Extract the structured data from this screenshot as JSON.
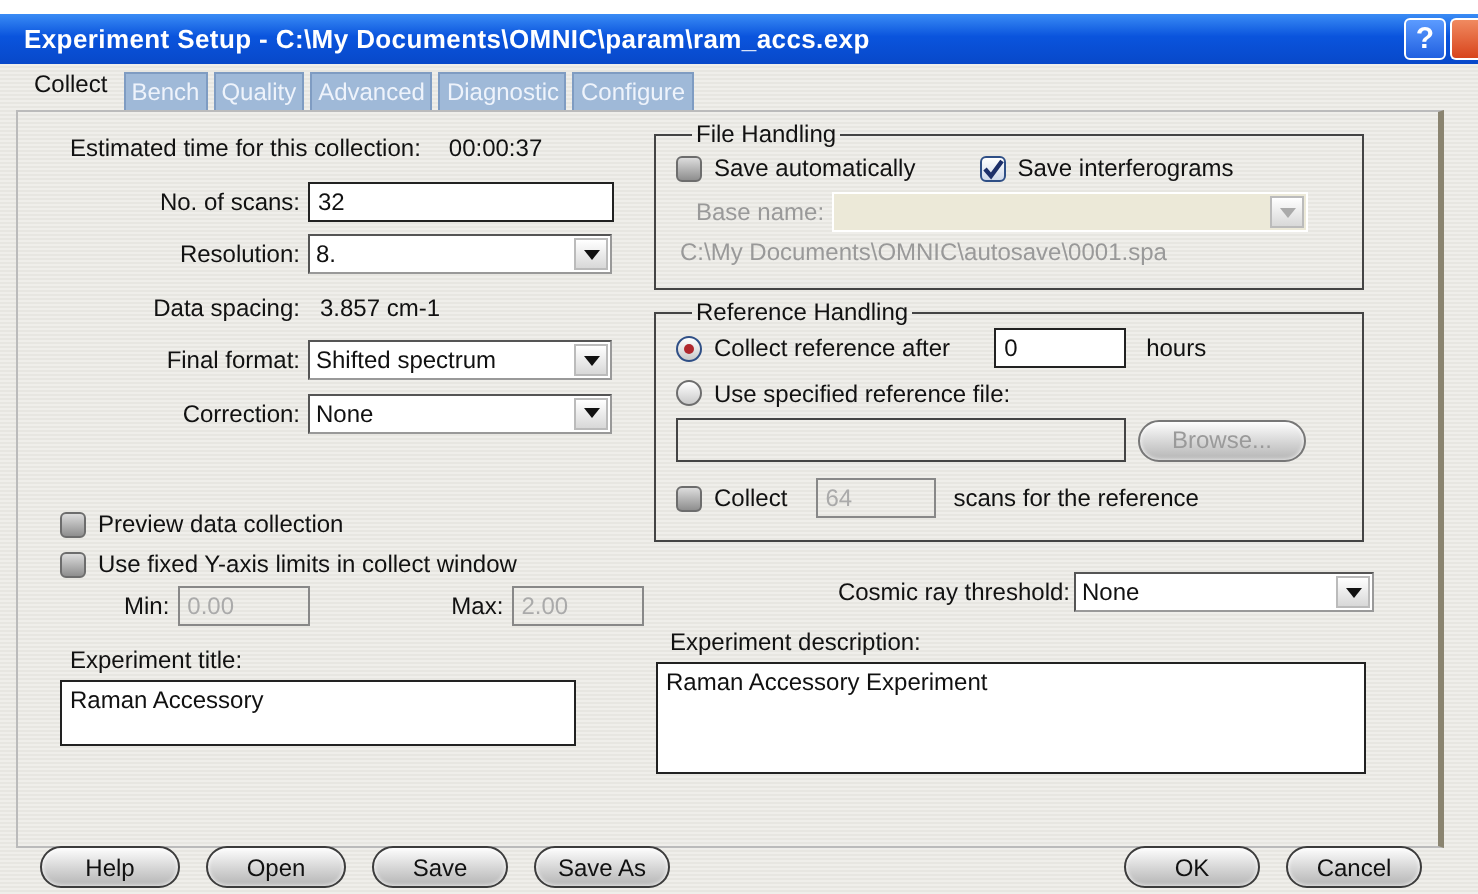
{
  "window": {
    "title": "Experiment Setup - C:\\My Documents\\OMNIC\\param\\ram_accs.exp",
    "help_button": "?"
  },
  "tabs": [
    {
      "label": "Collect",
      "selected": true
    },
    {
      "label": "Bench",
      "selected": false
    },
    {
      "label": "Quality",
      "selected": false
    },
    {
      "label": "Advanced",
      "selected": false
    },
    {
      "label": "Diagnostic",
      "selected": false
    },
    {
      "label": "Configure",
      "selected": false
    }
  ],
  "estimate": {
    "label": "Estimated time for this collection:",
    "value": "00:00:37"
  },
  "left_fields": [
    {
      "kind": "input",
      "label": "No. of scans:",
      "value": "32"
    },
    {
      "kind": "dropdown",
      "label": "Resolution:",
      "value": "8."
    },
    {
      "kind": "text",
      "label": "Data spacing:",
      "value": "3.857 cm-1"
    },
    {
      "kind": "dropdown",
      "label": "Final format:",
      "value": "Shifted spectrum"
    },
    {
      "kind": "dropdown",
      "label": "Correction:",
      "value": "None"
    }
  ],
  "options": [
    {
      "label": "Preview data collection",
      "checked": false
    },
    {
      "label": "Use fixed Y-axis limits in collect window",
      "checked": false
    }
  ],
  "limits": [
    {
      "label": "Min:",
      "value": "0.00",
      "disabled": true
    },
    {
      "label": "Max:",
      "value": "2.00",
      "disabled": true
    }
  ],
  "experiment_title": {
    "label": "Experiment title:",
    "value": "Raman Accessory"
  },
  "file_handling": {
    "title": "File Handling",
    "checkboxes": [
      {
        "label": "Save automatically",
        "checked": false
      },
      {
        "label": "Save interferograms",
        "checked": true
      }
    ],
    "base_name": {
      "label": "Base name:",
      "disabled": true
    },
    "path": "C:\\My Documents\\OMNIC\\autosave\\0001.spa"
  },
  "reference_handling": {
    "title": "Reference Handling",
    "radios": [
      {
        "label": "Collect reference after",
        "selected": true
      },
      {
        "label": "Use specified reference file:",
        "selected": false
      }
    ],
    "hours": {
      "value": "0",
      "unit": "hours"
    },
    "file": {
      "disabled": true
    },
    "browse": {
      "label": "Browse...",
      "disabled": true
    },
    "collect": {
      "label": "Collect",
      "checked": false,
      "value": "64",
      "disabled": true,
      "suffix": "scans for the reference"
    }
  },
  "cosmic_ray": {
    "label": "Cosmic ray threshold:",
    "value": "None"
  },
  "experiment_description": {
    "label": "Experiment description:",
    "value": "Raman Accessory Experiment"
  },
  "buttons_left": [
    "Help",
    "Open",
    "Save",
    "Save As"
  ],
  "buttons_right": [
    "OK",
    "Cancel"
  ]
}
